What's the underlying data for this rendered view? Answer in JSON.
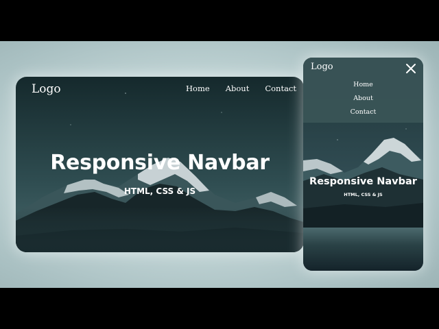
{
  "desktop": {
    "logo": "Logo",
    "nav": [
      "Home",
      "About",
      "Contact"
    ],
    "title": "Responsive Navbar",
    "subtitle": "HTML, CSS & JS"
  },
  "mobile": {
    "logo": "Logo",
    "menu": [
      "Home",
      "About",
      "Contact"
    ],
    "close_icon": "close-icon",
    "title": "Responsive Navbar",
    "subtitle": "HTML, CSS & JS"
  },
  "colors": {
    "sky_top": "#15292c",
    "sky_bottom": "#3e5f63",
    "mountain_dark": "#0e1a1d",
    "snow": "#c9d3d6",
    "text": "#ffffff",
    "stage_background": "#c3d6d7"
  }
}
